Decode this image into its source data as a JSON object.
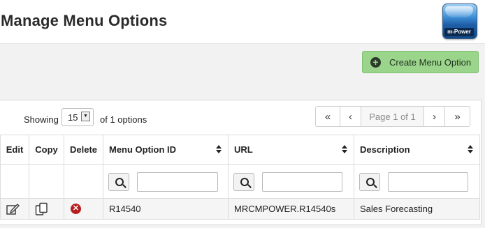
{
  "page": {
    "title": "Manage Menu Options",
    "logo_text": "m-Power"
  },
  "toolbar": {
    "create_label": "Create Menu Option",
    "create_icon": "plus-circle-icon",
    "accent": "#9bd58c"
  },
  "pagination": {
    "showing_label": "Showing",
    "per_page": "15",
    "count_label": "of 1 options",
    "first": "«",
    "prev": "‹",
    "info": "Page 1 of 1",
    "next": "›",
    "last": "»"
  },
  "table": {
    "columns": [
      "Edit",
      "Copy",
      "Delete",
      "Menu Option ID",
      "URL",
      "Description"
    ],
    "rows": [
      {
        "menu_option_id": "R14540",
        "url": "MRCMPOWER.R14540s",
        "description": "Sales Forecasting"
      }
    ],
    "filters": {
      "menu_option_id": "",
      "url": "",
      "description": ""
    }
  }
}
